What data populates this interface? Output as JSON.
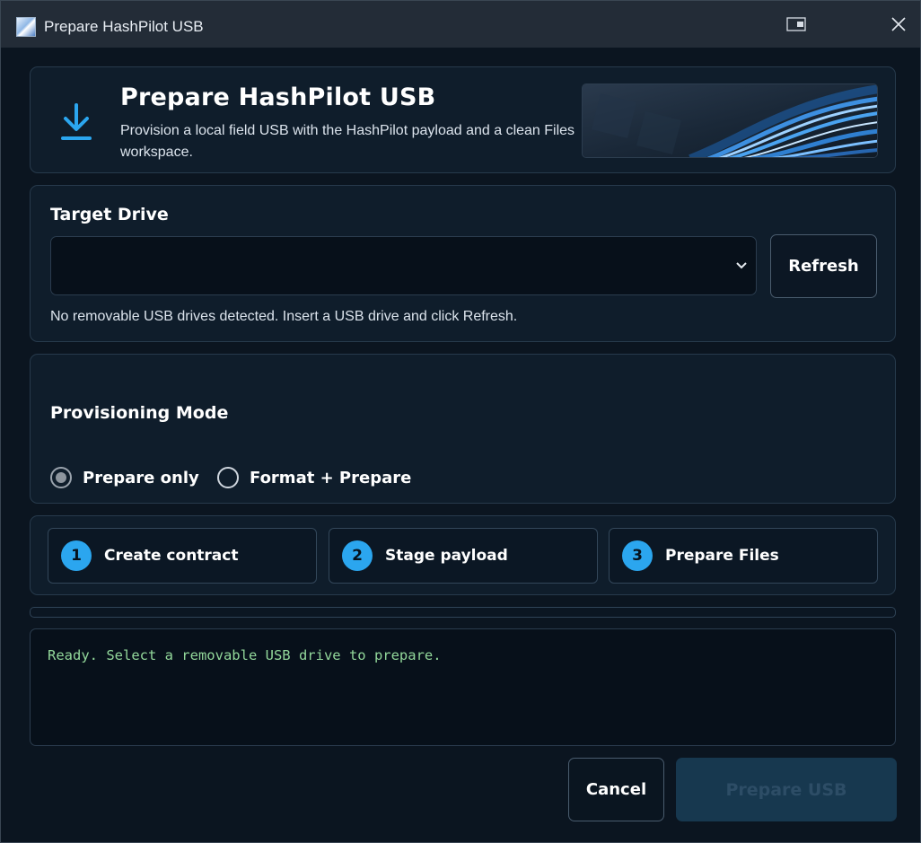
{
  "window": {
    "title": "Prepare HashPilot USB",
    "icons": {
      "app": "app-icon",
      "snap": "snap-layout-icon",
      "close": "close-icon"
    }
  },
  "header": {
    "icon": "download-icon",
    "title": "Prepare HashPilot USB",
    "subtitle": "Provision a local field USB with the HashPilot payload and a clean Files workspace.",
    "accent_color": "#2ba6ef"
  },
  "target_drive": {
    "heading": "Target Drive",
    "selected_value": "",
    "refresh_label": "Refresh",
    "hint": "No removable USB drives detected. Insert a USB drive and click Refresh."
  },
  "provisioning_mode": {
    "heading": "Provisioning Mode",
    "options": [
      {
        "label": "Prepare only",
        "checked": true
      },
      {
        "label": "Format + Prepare",
        "checked": false
      }
    ]
  },
  "steps": [
    {
      "number": "1",
      "label": "Create contract"
    },
    {
      "number": "2",
      "label": "Stage payload"
    },
    {
      "number": "3",
      "label": "Prepare Files"
    }
  ],
  "progress": {
    "value": 0
  },
  "log": {
    "text": "Ready. Select a removable USB drive to prepare."
  },
  "footer": {
    "cancel_label": "Cancel",
    "prepare_label": "Prepare USB",
    "prepare_enabled": false
  }
}
